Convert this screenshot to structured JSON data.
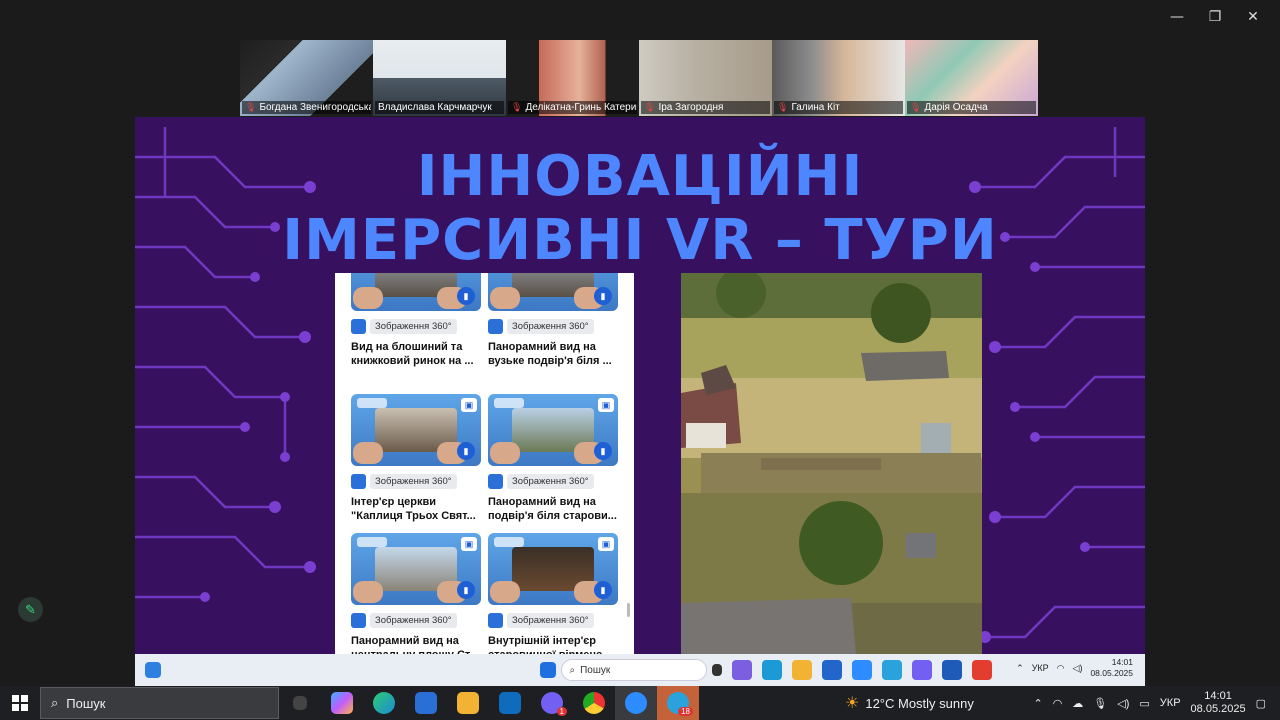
{
  "window": {
    "minimize": "—",
    "restore": "❐",
    "close": "✕"
  },
  "participants": [
    {
      "name": "Богдана Звенигородська",
      "active": false
    },
    {
      "name": "Владислава Карчмарчук",
      "active": true
    },
    {
      "name": "Делікатна-Гринь Катерина",
      "active": false
    },
    {
      "name": "Іра  Загородня",
      "active": false
    },
    {
      "name": "Галина Кіт",
      "active": false
    },
    {
      "name": "Дарія Осадча",
      "active": false
    }
  ],
  "slide": {
    "title_line1": "ІННОВАЦІЙНІ",
    "title_line2": "ІМЕРСИВНІ VR – ТУРИ",
    "cards": [
      {
        "badge": "Зображення 360°",
        "title": "Вид на блошиний та книжковий ринок на ..."
      },
      {
        "badge": "Зображення 360°",
        "title": "Панорамний вид на вузьке подвір'я біля ..."
      },
      {
        "badge": "Зображення 360°",
        "title": "Інтер'єр церкви \"Каплиця Трьох Свят..."
      },
      {
        "badge": "Зображення 360°",
        "title": "Панорамний вид на подвір'я біля старови..."
      },
      {
        "badge": "Зображення 360°",
        "title": "Панорамний вид на центральну площу Ст..."
      },
      {
        "badge": "Зображення 360°",
        "title": "Внутрішній інтер'єр старовинної вірменс..."
      }
    ]
  },
  "inner_taskbar": {
    "search": "Пошук",
    "lang": "УКР",
    "time": "14:01",
    "date": "08.05.2025"
  },
  "taskbar": {
    "search": "Пошук",
    "weather": "12°C  Mostly sunny",
    "lang": "УКР",
    "time": "14:01",
    "date": "08.05.2025",
    "viber_count": "1",
    "telegram_count": "18"
  }
}
